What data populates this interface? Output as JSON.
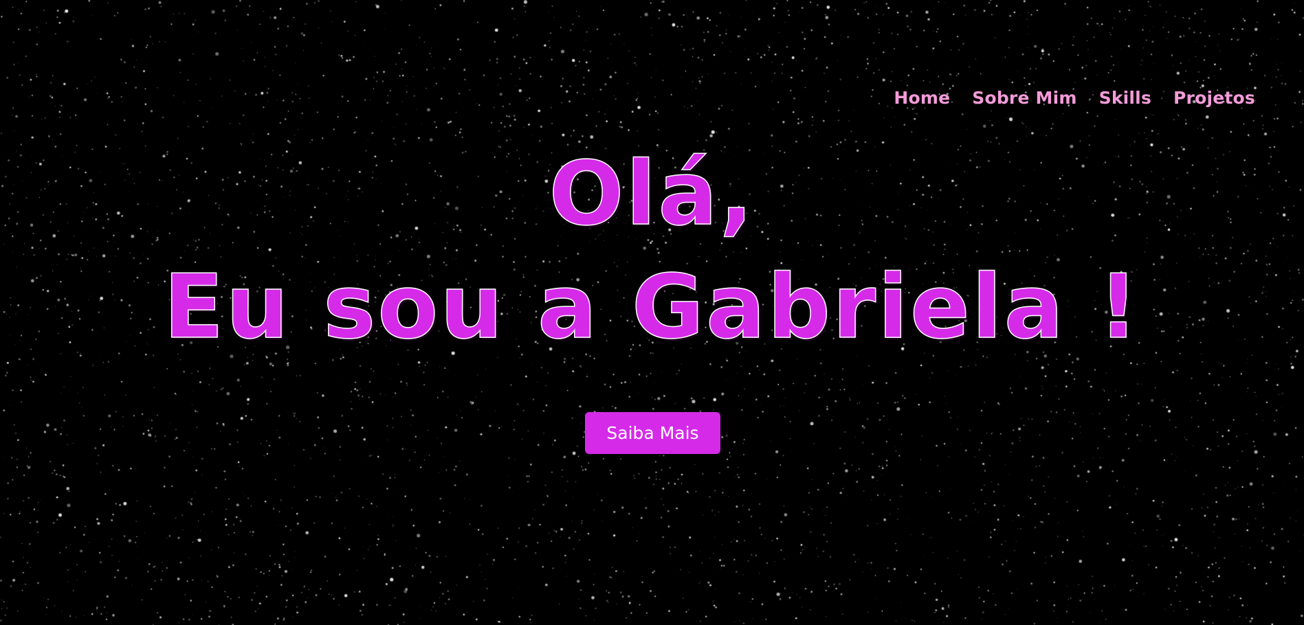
{
  "nav": {
    "items": [
      {
        "label": "Home"
      },
      {
        "label": "Sobre Mim"
      },
      {
        "label": "Skills"
      },
      {
        "label": "Projetos"
      }
    ]
  },
  "hero": {
    "line1": "Olá,",
    "line2": "Eu sou a Gabriela !",
    "button_label": "Saiba Mais"
  },
  "colors": {
    "background": "#000000",
    "accent": "#d52be9",
    "nav_text": "#f39bd9",
    "stars": "#ffffff"
  }
}
